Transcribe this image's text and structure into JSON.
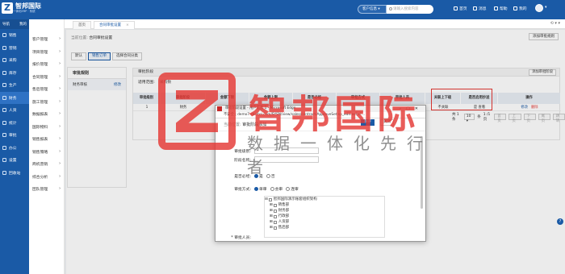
{
  "topbar": {
    "logo_text": "智邦国际",
    "logo_sub": "一体化ERP · 系统",
    "scope": "客户信息 ▾",
    "search_placeholder": "请输入搜索内容",
    "links": [
      "首页",
      "消息",
      "帮助",
      "我的"
    ],
    "user": "▾"
  },
  "sidebar": {
    "head_left": "导航",
    "head_right": "我的",
    "items": [
      "销售",
      "营销",
      "采购",
      "库存",
      "生产",
      "财务",
      "人资",
      "统计",
      "审批",
      "办公",
      "设置",
      "回收站"
    ],
    "active_index": 5
  },
  "subsidebar": {
    "items": [
      "客户管理",
      "项目管理",
      "报价管理",
      "合同管理",
      "售后管理",
      "施工管理",
      "数据报表",
      "国际物料",
      "销售报表",
      "销售策略",
      "商机营销",
      "综合分析",
      "团队管理"
    ]
  },
  "tabs": [
    {
      "label": "首页"
    },
    {
      "label": "合同审批设置",
      "close": "×"
    }
  ],
  "tab_tools": "⟲ ▾ ▾",
  "page": {
    "crumb_label": "当前位置:",
    "crumb_value": "合同审批设置",
    "add_rule_label": "添加审批规则",
    "subtabs": [
      "默认",
      "销售订单",
      "选择合同分类"
    ],
    "rule_panel_title": "审批规则",
    "rule_name": "财务审核",
    "rule_edit": "修改",
    "stage_title": "审批阶段",
    "add_stage": "添加审批阶段",
    "applies_label": "适用范围:",
    "applies_value": "采购数"
  },
  "table": {
    "headers": [
      "审批级别",
      "审批阶段",
      "金额下限",
      "金额上限",
      "是否必经",
      "审批方式",
      "审批人员",
      "关联上下级",
      "是否启用抄送",
      "操作"
    ],
    "rows": [
      {
        "level": "1",
        "stage": "财务",
        "min": "",
        "max": "",
        "required": "",
        "method": "",
        "approver": "",
        "linked": "不关联",
        "cc": "是 查看",
        "edit": "修改",
        "delete": "删除"
      }
    ]
  },
  "pager": {
    "total": "共 1 条",
    "per_page": "10 ▾",
    "per_label": "条",
    "page_text": "1 /1页",
    "buttons": [
      "首页",
      "上页",
      "下页",
      "尾页",
      "跳转"
    ]
  },
  "dialog": {
    "window_title": "审批阶段设置 - 用户信息 1 - Microsoft Edge",
    "url": "不安全 | demo7.zbintel.com/SYSN/view/sales/contract/ApproveSet/sp_edit.ashx?...",
    "crumb_label": "当前位置:",
    "crumb_value": "审批阶段添加",
    "save": "保存",
    "close": "关闭",
    "level_label": "审批级别:",
    "level_value": "2",
    "name_label": "阶段名称:",
    "required_label": "是否必经:",
    "required_opts": [
      "是",
      "否"
    ],
    "method_label": "审批方式:",
    "method_opts": [
      "单审",
      "会审",
      "连审"
    ],
    "approver_label": "* 审批人员:",
    "tree": [
      "智邦国际演示账套组织架构",
      "销售部",
      "财务部",
      "行政部",
      "人资部",
      "售后部"
    ]
  },
  "watermark": {
    "cn": "智邦国际",
    "sub": "数据一体化先行者"
  },
  "help": "?"
}
